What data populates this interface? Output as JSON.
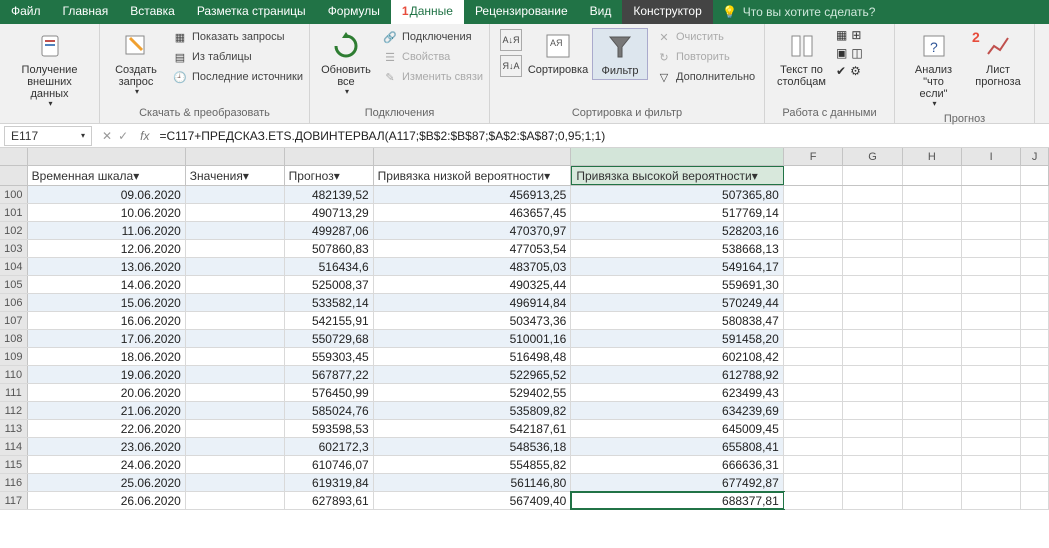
{
  "tabs": {
    "file": "Файл",
    "home": "Главная",
    "insert": "Вставка",
    "layout": "Разметка страницы",
    "formulas": "Формулы",
    "data": "Данные",
    "review": "Рецензирование",
    "view": "Вид",
    "design": "Конструктор",
    "tellme": "Что вы хотите сделать?",
    "mark1": "1"
  },
  "ribbon": {
    "g1": {
      "label": "",
      "btn": "Получение\nвнешних данных"
    },
    "g2": {
      "label": "Скачать & преобразовать",
      "btn": "Создать\nзапрос",
      "i1": "Показать запросы",
      "i2": "Из таблицы",
      "i3": "Последние источники"
    },
    "g3": {
      "label": "Подключения",
      "btn": "Обновить\nвсе",
      "i1": "Подключения",
      "i2": "Свойства",
      "i3": "Изменить связи"
    },
    "g4": {
      "label": "Сортировка и фильтр",
      "s1": "",
      "s2": "",
      "btn1": "Сортировка",
      "btn2": "Фильтр",
      "i1": "Очистить",
      "i2": "Повторить",
      "i3": "Дополнительно"
    },
    "g5": {
      "label": "Работа с данными",
      "btn": "Текст по\nстолбцам"
    },
    "g6": {
      "label": "Прогноз",
      "btn1": "Анализ \"что\nесли\"",
      "btn2": "Лист\nпрогноза",
      "mark2": "2"
    }
  },
  "formula": {
    "cell": "E117",
    "fx": "=C117+ПРЕДСКАЗ.ETS.ДОВИНТЕРВАЛ(A117;$B$2:$B$87;$A$2:$A$87;0,95;1;1)"
  },
  "colLetters": [
    "F",
    "G",
    "H",
    "I",
    "J"
  ],
  "widths": {
    "A": 160,
    "B": 100,
    "C": 90,
    "D": 200,
    "E": 215,
    "F": 60,
    "G": 60,
    "H": 60,
    "I": 60,
    "J": 28
  },
  "tableHeaders": {
    "A": "Временная шкала",
    "B": "Значения",
    "C": "Прогноз",
    "D": "Привязка низкой вероятности",
    "E": "Привязка высокой вероятности"
  },
  "rows": [
    {
      "n": 100,
      "A": "09.06.2020",
      "C": "482139,52",
      "D": "456913,25",
      "E": "507365,80"
    },
    {
      "n": 101,
      "A": "10.06.2020",
      "C": "490713,29",
      "D": "463657,45",
      "E": "517769,14"
    },
    {
      "n": 102,
      "A": "11.06.2020",
      "C": "499287,06",
      "D": "470370,97",
      "E": "528203,16"
    },
    {
      "n": 103,
      "A": "12.06.2020",
      "C": "507860,83",
      "D": "477053,54",
      "E": "538668,13"
    },
    {
      "n": 104,
      "A": "13.06.2020",
      "C": "516434,6",
      "D": "483705,03",
      "E": "549164,17"
    },
    {
      "n": 105,
      "A": "14.06.2020",
      "C": "525008,37",
      "D": "490325,44",
      "E": "559691,30"
    },
    {
      "n": 106,
      "A": "15.06.2020",
      "C": "533582,14",
      "D": "496914,84",
      "E": "570249,44"
    },
    {
      "n": 107,
      "A": "16.06.2020",
      "C": "542155,91",
      "D": "503473,36",
      "E": "580838,47"
    },
    {
      "n": 108,
      "A": "17.06.2020",
      "C": "550729,68",
      "D": "510001,16",
      "E": "591458,20"
    },
    {
      "n": 109,
      "A": "18.06.2020",
      "C": "559303,45",
      "D": "516498,48",
      "E": "602108,42"
    },
    {
      "n": 110,
      "A": "19.06.2020",
      "C": "567877,22",
      "D": "522965,52",
      "E": "612788,92"
    },
    {
      "n": 111,
      "A": "20.06.2020",
      "C": "576450,99",
      "D": "529402,55",
      "E": "623499,43"
    },
    {
      "n": 112,
      "A": "21.06.2020",
      "C": "585024,76",
      "D": "535809,82",
      "E": "634239,69"
    },
    {
      "n": 113,
      "A": "22.06.2020",
      "C": "593598,53",
      "D": "542187,61",
      "E": "645009,45"
    },
    {
      "n": 114,
      "A": "23.06.2020",
      "C": "602172,3",
      "D": "548536,18",
      "E": "655808,41"
    },
    {
      "n": 115,
      "A": "24.06.2020",
      "C": "610746,07",
      "D": "554855,82",
      "E": "666636,31"
    },
    {
      "n": 116,
      "A": "25.06.2020",
      "C": "619319,84",
      "D": "561146,80",
      "E": "677492,87"
    },
    {
      "n": 117,
      "A": "26.06.2020",
      "C": "627893,61",
      "D": "567409,40",
      "E": "688377,81"
    }
  ]
}
